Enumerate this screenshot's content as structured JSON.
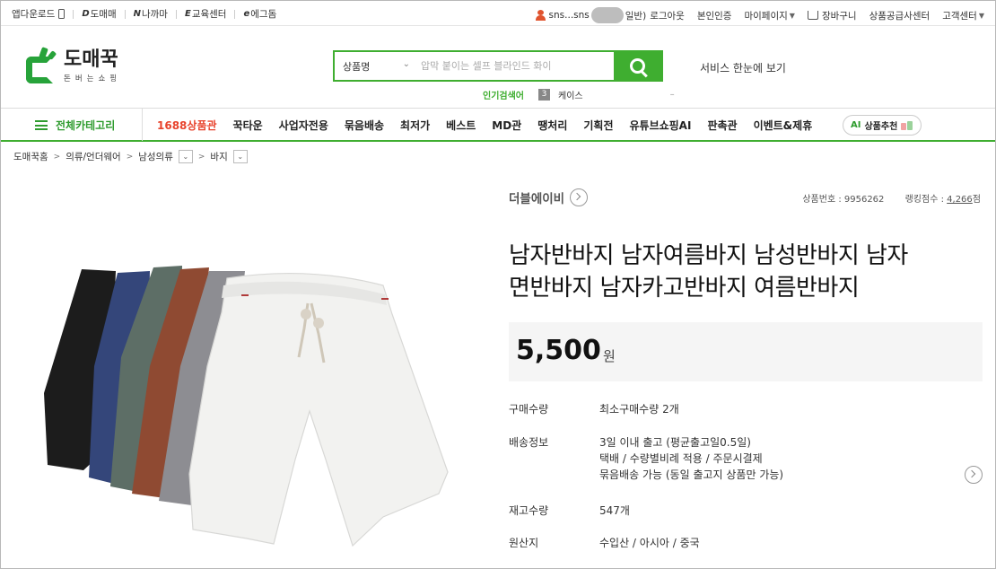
{
  "topbar": {
    "left": [
      {
        "label": "앱다운로드",
        "icon": "phone-icon"
      },
      {
        "label": "도매매",
        "icon": "d-logo-icon"
      },
      {
        "label": "나까마",
        "icon": "n-logo-icon"
      },
      {
        "label": "교육센터",
        "icon": "edu-icon"
      },
      {
        "label": "에그돔",
        "icon": "egg-icon"
      }
    ],
    "user": {
      "prefix": "sns...sns",
      "suffix": "일반)",
      "logout": "로그아웃"
    },
    "verify": "본인인증",
    "mypage": "마이페이지",
    "cart": "장바구니",
    "supplier": "상품공급사센터",
    "support": "고객센터"
  },
  "logo": {
    "name": "도매꾹",
    "tagline": "돈버는쇼핑"
  },
  "search": {
    "category": "상품명",
    "placeholder": "압막 붙이는 셀프 블라인드 화이",
    "hot_label": "인기검색어",
    "hot_rank": "3",
    "hot_term": "케이스",
    "hot_dash": "–"
  },
  "service_link": "서비스 한눈에 보기",
  "nav": {
    "all_category": "전체카테고리",
    "items": [
      "1688상품관",
      "꾹타운",
      "사업자전용",
      "묶음배송",
      "최저가",
      "베스트",
      "MD관",
      "땡처리",
      "기획전",
      "유튜브쇼핑AI",
      "판촉관",
      "이벤트&제휴"
    ],
    "ai_badge": "AI",
    "ai_label": "상품추천"
  },
  "breadcrumb": [
    "도매꾹홈",
    "의류/언더웨어",
    "남성의류",
    "바지"
  ],
  "product": {
    "brand": "더블에이비",
    "id_label": "상품번호 : 9956262",
    "rank_label": "랭킹점수 :",
    "rank_value": "4,266",
    "rank_unit": "점",
    "title_line1": "남자반바지 남자여름바지 남성반바지 남자",
    "title_line2": "면반바지 남자카고반바지 여름반바지",
    "price": "5,500",
    "currency": "원",
    "info": {
      "qty_key": "구매수량",
      "qty_val_pre": "최소구매수량",
      "qty_val": "2개",
      "ship_key": "배송정보",
      "ship_l1": "3일 이내 출고 (평균출고일0.5일)",
      "ship_l2": "택배 / 수량별비례 적용 / 주문시결제",
      "ship_l3": "묶음배송 가능 (동일 출고지 상품만 가능)",
      "stock_key": "재고수량",
      "stock_val": "547개",
      "origin_key": "원산지",
      "origin_val": "수입산 / 아시아 / 중국"
    }
  },
  "colors": {
    "brand_green": "#3fae30",
    "red_menu": "#e8432c",
    "shorts": [
      "#1c1c1c",
      "#34467a",
      "#5d6e66",
      "#8f4a32",
      "#8d8d92",
      "#f2f2f0"
    ]
  }
}
